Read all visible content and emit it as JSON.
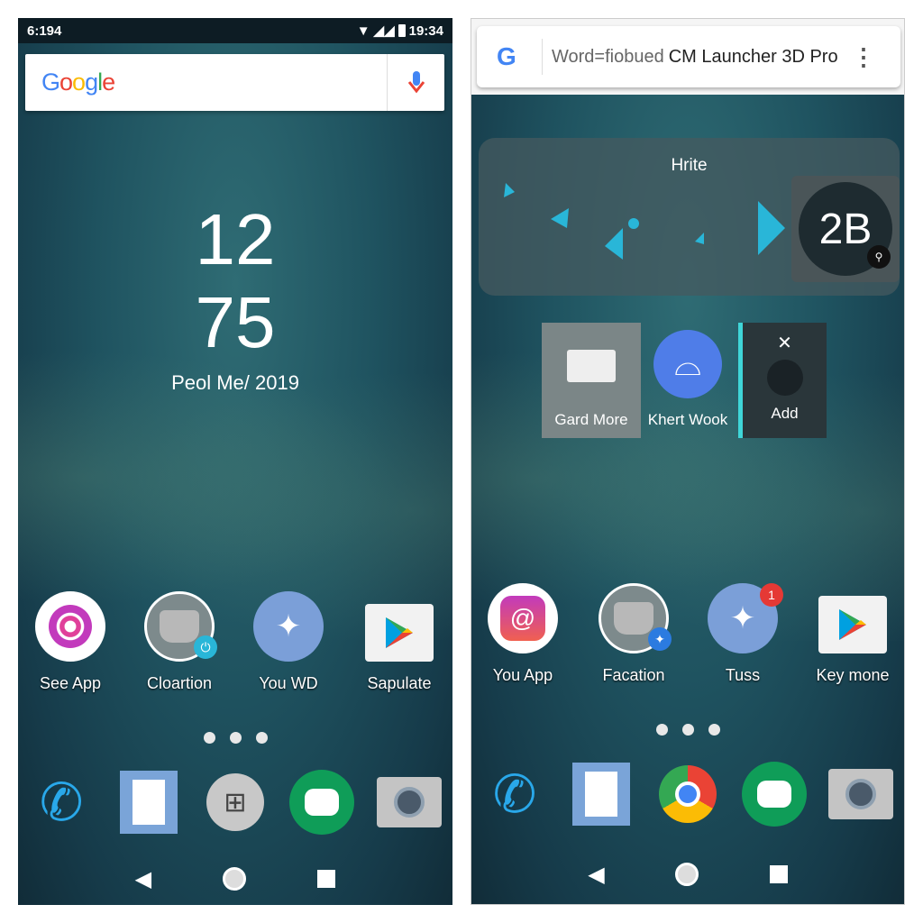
{
  "left": {
    "status": {
      "left_time": "6:194",
      "right_time": "19:34"
    },
    "search": {
      "logo": "Google",
      "icon": "mic-icon"
    },
    "clock": {
      "hour": "12",
      "minute": "75",
      "date": "Peol Me/ 2019"
    },
    "apps": [
      {
        "label": "See App",
        "icon": "instagram-like-icon"
      },
      {
        "label": "Cloartion",
        "icon": "castle-icon"
      },
      {
        "label": "You WD",
        "icon": "sparkle-icon"
      },
      {
        "label": "Sapulate",
        "icon": "play-store-icon"
      }
    ],
    "dock": [
      "phone-icon",
      "notes-icon",
      "apps-grid-icon",
      "hangouts-icon",
      "camera-icon"
    ]
  },
  "right": {
    "search": {
      "text_light": "Word=fiobued",
      "text_bold": "CM Launcher 3D Pro",
      "icon": "google-g-icon"
    },
    "widget": {
      "title": "Hrite",
      "value": "2B"
    },
    "tiles": [
      {
        "label": "Gard More",
        "icon": "mail-icon"
      },
      {
        "label": "Khert Wook",
        "icon": "contact-icon"
      },
      {
        "label": "Add",
        "icon": "clock-icon"
      }
    ],
    "apps": [
      {
        "label": "You App",
        "icon": "instagram-like-icon"
      },
      {
        "label": "Facation",
        "icon": "castle-icon"
      },
      {
        "label": "Tuss",
        "icon": "sparkle-icon",
        "badge": "1"
      },
      {
        "label": "Key mone",
        "icon": "play-store-icon"
      }
    ],
    "dock": [
      "phone-icon",
      "notes-icon",
      "chrome-icon",
      "hangouts-icon",
      "camera-icon"
    ]
  },
  "colors": {
    "accent": "#29b6d8",
    "google_blue": "#4285f4",
    "badge_red": "#e53935"
  }
}
